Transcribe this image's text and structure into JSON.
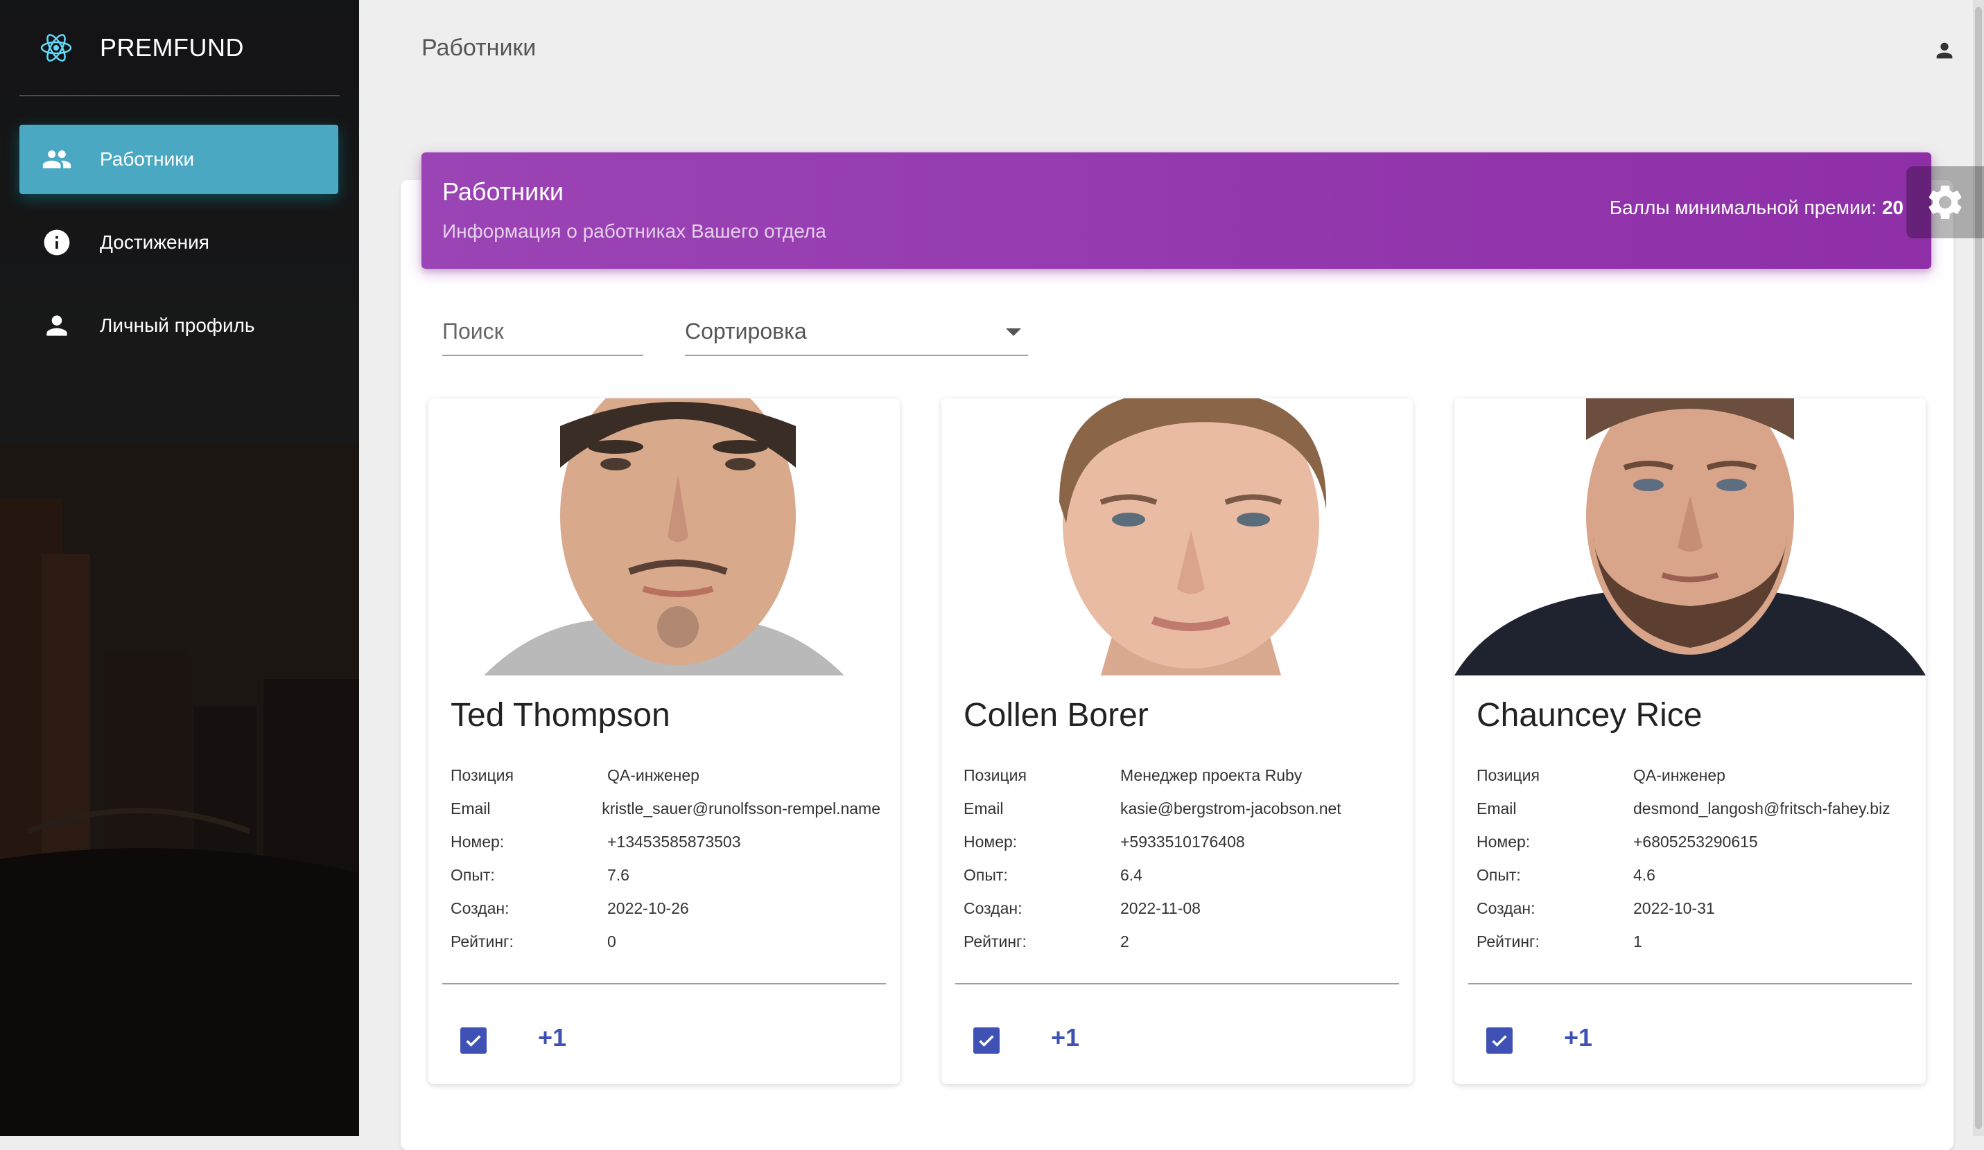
{
  "sidebar": {
    "brand": "PREMFUND",
    "items": [
      {
        "label": "Работники",
        "icon": "people-icon",
        "active": true
      },
      {
        "label": "Достижения",
        "icon": "info-icon",
        "active": false
      },
      {
        "label": "Личный профиль",
        "icon": "person-icon",
        "active": false
      }
    ]
  },
  "topbar": {
    "title": "Работники",
    "user_icon": "person-icon"
  },
  "header": {
    "title": "Работники",
    "subtitle": "Информация о работниках Вашего отдела",
    "bonus_label": "Баллы минимальной премии:",
    "bonus_value": "20"
  },
  "filters": {
    "search_placeholder": "Поиск",
    "sort_label": "Сортировка"
  },
  "labels": {
    "position": "Позиция",
    "email": "Email",
    "phone": "Номер:",
    "experience": "Опыт:",
    "created": "Создан:",
    "rating": "Рейтинг:"
  },
  "employees": [
    {
      "name": "Ted Thompson",
      "position": "QA-инженер",
      "email": "kristle_sauer@runolfsson-rempel.name",
      "phone": "+13453585873503",
      "experience": "7.6",
      "created": "2022-10-26",
      "rating": "0",
      "checked": true,
      "plus": "+1"
    },
    {
      "name": "Collen Borer",
      "position": "Менеджер проекта Ruby",
      "email": "kasie@bergstrom-jacobson.net",
      "phone": "+5933510176408",
      "experience": "6.4",
      "created": "2022-11-08",
      "rating": "2",
      "checked": true,
      "plus": "+1"
    },
    {
      "name": "Chauncey Rice",
      "position": "QA-инженер",
      "email": "desmond_langosh@fritsch-fahey.biz",
      "phone": "+6805253290615",
      "experience": "4.6",
      "created": "2022-10-31",
      "rating": "1",
      "checked": true,
      "plus": "+1"
    }
  ],
  "colors": {
    "active_nav": "#4aa8c3",
    "header": "#9b44b5",
    "accent": "#3f51b5"
  }
}
